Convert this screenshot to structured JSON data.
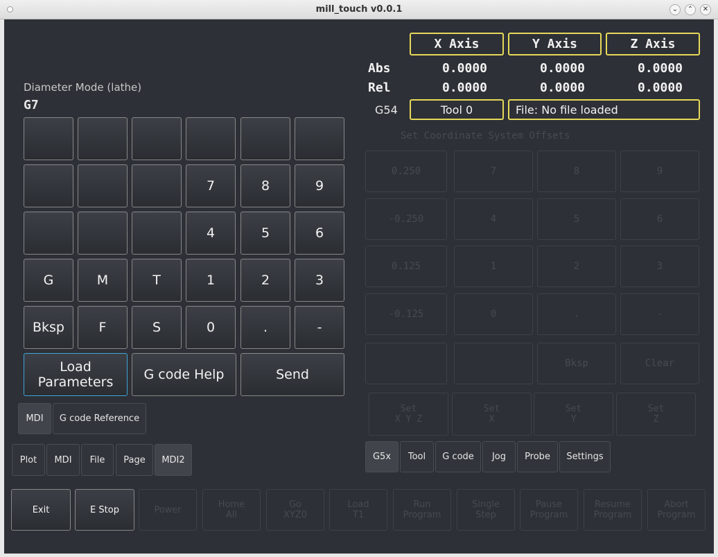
{
  "window": {
    "title": "mill_touch v0.0.1"
  },
  "mdi": {
    "mode_label": "Diameter Mode (lathe)",
    "code": "G7",
    "keypad": [
      [
        "",
        "",
        "",
        "",
        "",
        ""
      ],
      [
        "",
        "",
        "",
        "7",
        "8",
        "9"
      ],
      [
        "",
        "",
        "",
        "4",
        "5",
        "6"
      ],
      [
        "G",
        "M",
        "T",
        "1",
        "2",
        "3"
      ],
      [
        "Bksp",
        "F",
        "S",
        "0",
        ".",
        "-"
      ]
    ],
    "load_params": "Load\nParameters",
    "gcode_help": "G code Help",
    "send": "Send"
  },
  "subtabs": [
    "MDI",
    "G code Reference"
  ],
  "left_tabs": [
    "Plot",
    "MDI",
    "File",
    "Page",
    "MDI2"
  ],
  "dro": {
    "headers": [
      "X Axis",
      "Y Axis",
      "Z Axis"
    ],
    "abs_label": "Abs",
    "rel_label": "Rel",
    "abs": [
      "0.0000",
      "0.0000",
      "0.0000"
    ],
    "rel": [
      "0.0000",
      "0.0000",
      "0.0000"
    ],
    "coord_system": "G54",
    "tool": "Tool 0",
    "file": "File: No file loaded"
  },
  "offsets": {
    "title": "Set Coordinate System Offsets",
    "grid": [
      [
        "0.250",
        "7",
        "8",
        "9"
      ],
      [
        "-0.250",
        "4",
        "5",
        "6"
      ],
      [
        "0.125",
        "1",
        "2",
        "3"
      ],
      [
        "-0.125",
        "0",
        ".",
        "-"
      ],
      [
        "",
        "",
        "Bksp",
        "Clear"
      ]
    ],
    "set_buttons": [
      "Set\nX Y Z",
      "Set\nX",
      "Set\nY",
      "Set\nZ"
    ]
  },
  "right_tabs": [
    "G5x",
    "Tool",
    "G code",
    "Jog",
    "Probe",
    "Settings"
  ],
  "bottom_bar": [
    "Exit",
    "E Stop",
    "Power",
    "Home\nAll",
    "Go\nXYZ0",
    "Load\nT1",
    "Run\nProgram",
    "Single\nStep",
    "Pause\nProgram",
    "Resume\nProgram",
    "Abort\nProgram"
  ],
  "colors": {
    "background": "#2d3036",
    "highlight": "#e6d85a",
    "focus": "#3fa5d6",
    "disabled_text": "#474b51"
  }
}
